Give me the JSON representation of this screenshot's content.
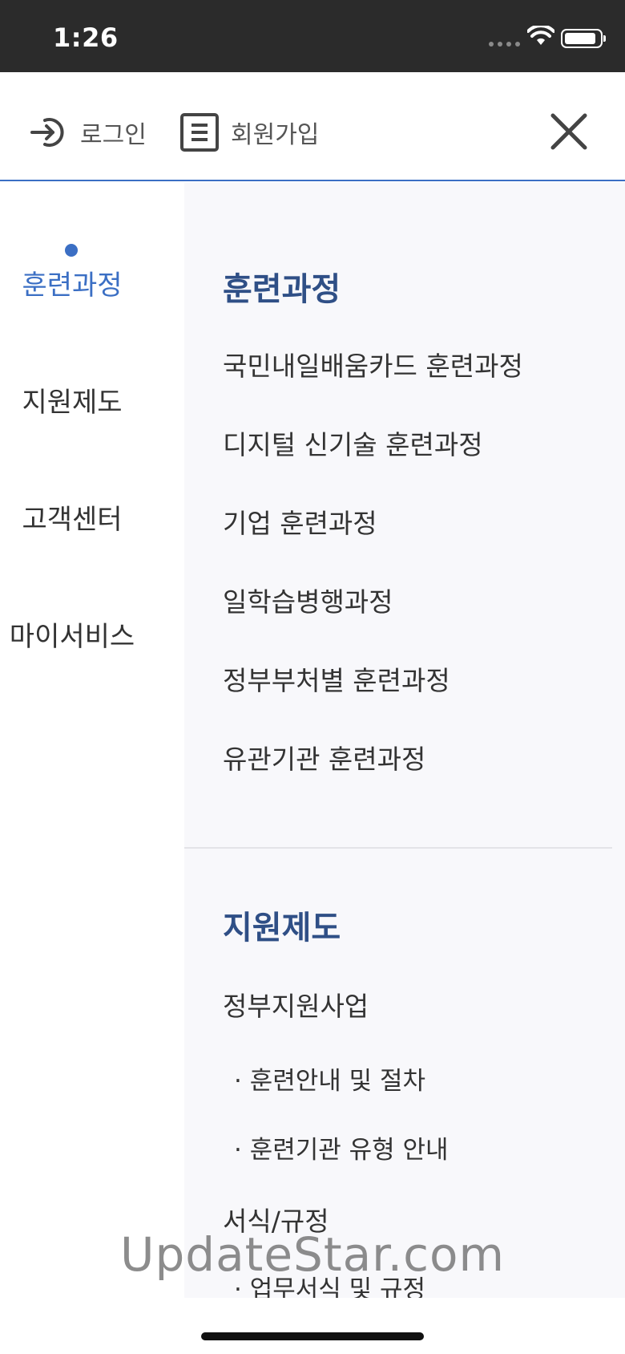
{
  "status_bar": {
    "time": "1:26"
  },
  "header": {
    "login_label": "로그인",
    "signup_label": "회원가입"
  },
  "left_nav": {
    "items": [
      {
        "label": "훈련과정",
        "active": true
      },
      {
        "label": "지원제도",
        "active": false
      },
      {
        "label": "고객센터",
        "active": false
      },
      {
        "label": "마이서비스",
        "active": false
      }
    ]
  },
  "sections": [
    {
      "title": "훈련과정",
      "links": [
        "국민내일배움카드 훈련과정",
        "디지털 신기술 훈련과정",
        "기업 훈련과정",
        "일학습병행과정",
        "정부부처별 훈련과정",
        "유관기관 훈련과정"
      ]
    },
    {
      "title": "지원제도",
      "links": [
        "정부지원사업",
        "· 훈련안내 및 절차",
        "· 훈련기관 유형 안내",
        "서식/규정",
        "· 업무서식 및 규정"
      ]
    }
  ],
  "watermark": "UpdateStar.com",
  "colors": {
    "accent": "#3b6fc4",
    "section_title": "#2f4f86",
    "panel_bg": "#f8f8fb"
  }
}
